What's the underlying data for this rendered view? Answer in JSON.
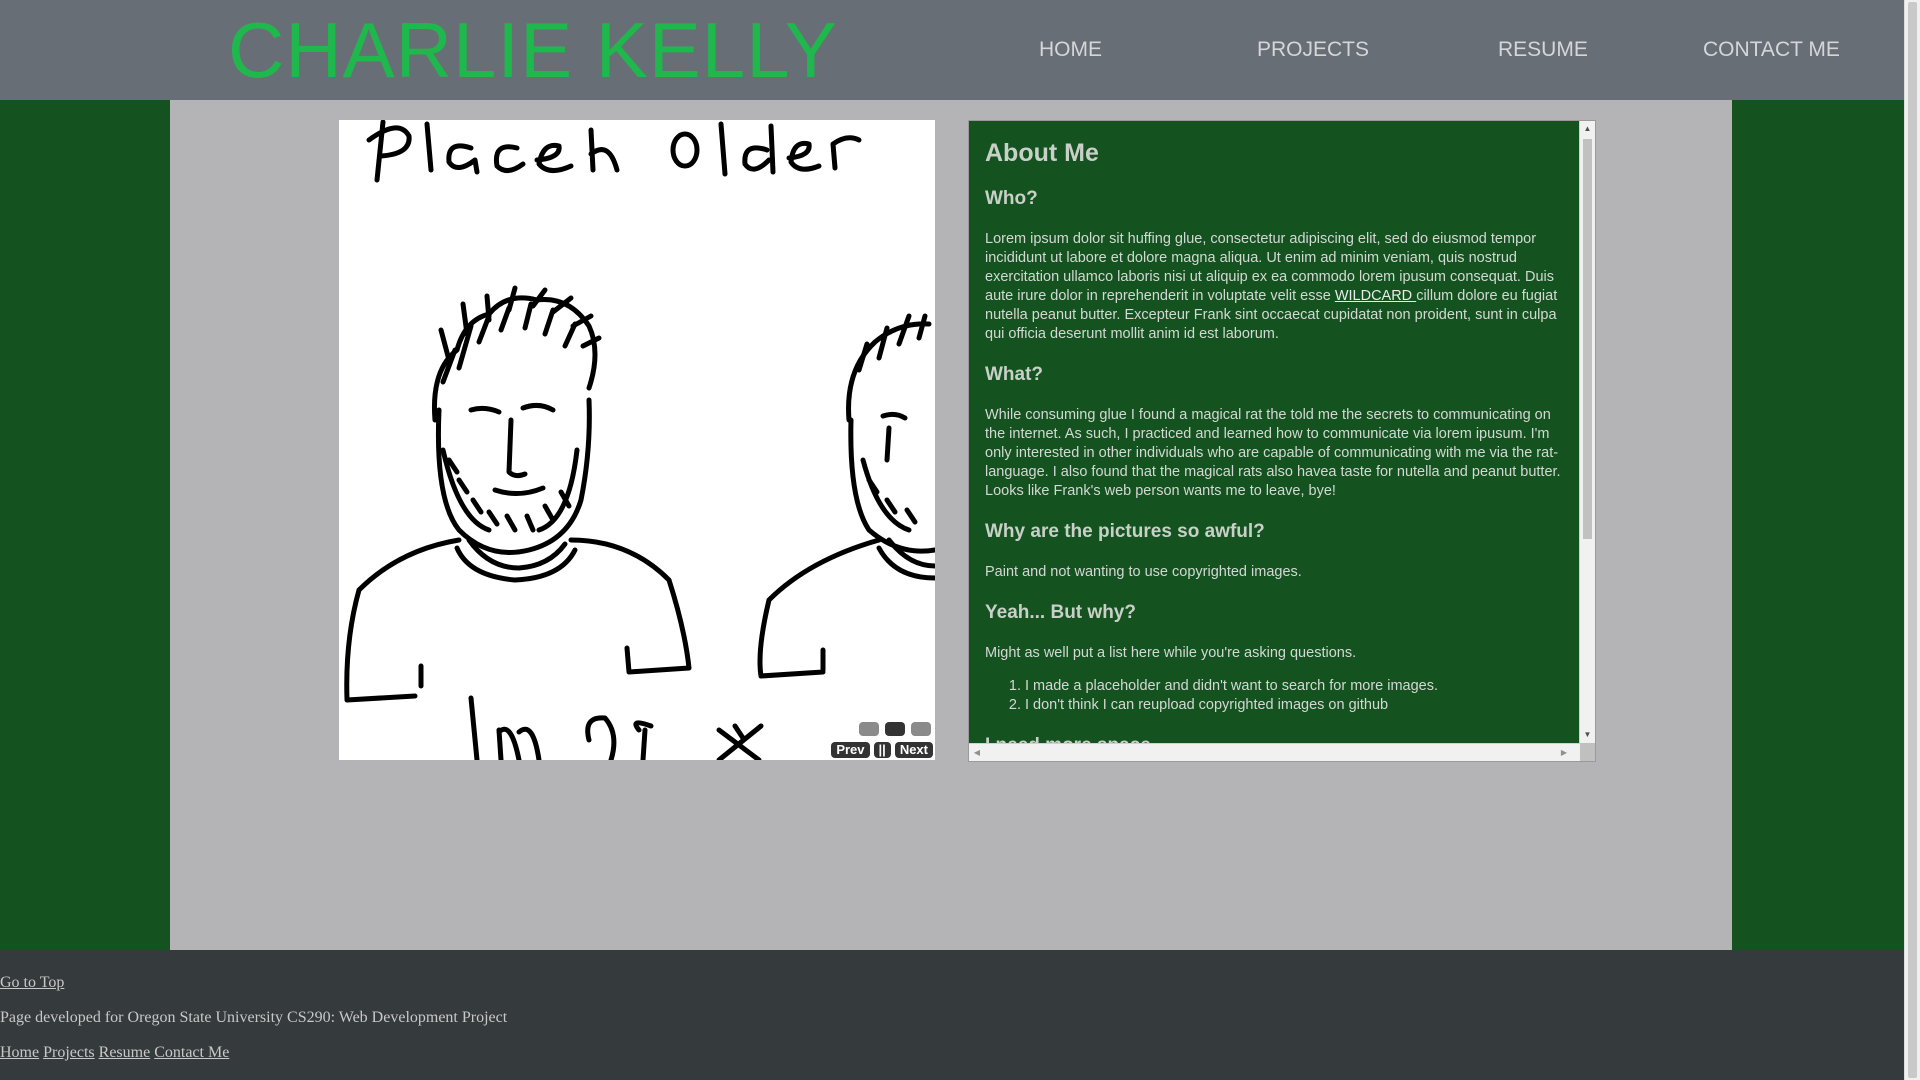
{
  "header": {
    "logo": "CHARLIE KELLY",
    "nav": [
      {
        "label": "HOME"
      },
      {
        "label": "PROJECTS"
      },
      {
        "label": "RESUME"
      },
      {
        "label": "CONTACT ME"
      }
    ]
  },
  "slideshow": {
    "image_alt_text": "Placeholder Image",
    "prev_label": "Prev",
    "pause_label": "||",
    "next_label": "Next",
    "slide_count": 3,
    "active_slide_index": 1
  },
  "about": {
    "title": "About Me",
    "sections": {
      "who": {
        "heading": "Who?",
        "text_before_link": "Lorem ipsum dolor sit huffing glue, consectetur adipiscing elit, sed do eiusmod tempor incididunt ut labore et dolore magna aliqua. Ut enim ad minim veniam, quis nostrud exercitation ullamco laboris nisi ut aliquip ex ea commodo lorem ipusum consequat. Duis aute irure dolor in reprehenderit in voluptate velit esse ",
        "link": "WILDCARD ",
        "text_after_link": "cillum dolore eu fugiat nutella peanut butter. Excepteur Frank sint occaecat cupidatat non proident, sunt in culpa qui officia deserunt mollit anim id est laborum."
      },
      "what": {
        "heading": "What?",
        "text": "While consuming glue I found a magical rat the told me the secrets to communicating on the internet. As such, I practiced and learned how to communicate via lorem ipusum. I'm only interested in other individuals who are capable of communicating with me via the rat-language. I also found that the magical rats also havea taste for nutella and peanut butter. Looks like Frank's web person wants me to leave, bye!"
      },
      "pictures": {
        "heading": "Why are the pictures so awful?",
        "text": "Paint and not wanting to use copyrighted images."
      },
      "why": {
        "heading": "Yeah... But why?",
        "text": "Might as well put a list here while you're asking questions.",
        "list": [
          "I made a placeholder and didn't want to search for more images.",
          "I don't think I can reupload copyrighted images on github"
        ]
      },
      "space": {
        "heading": "I need more space"
      }
    }
  },
  "footer": {
    "go_top": "Go to Top",
    "credit": "Page developed for Oregon State University CS290: Web Development Project",
    "links": [
      "Home",
      "Projects",
      "Resume",
      "Contact Me"
    ]
  },
  "colors": {
    "header_bg": "#686e75",
    "logo": "#1fb84c",
    "page_bg": "#14521f",
    "content_bg": "#b4b4b6",
    "footer_bg": "#353a3d"
  },
  "icons": [
    "scroll-up-arrow-icon",
    "scroll-down-arrow-icon",
    "scroll-left-arrow-icon",
    "scroll-right-arrow-icon"
  ]
}
